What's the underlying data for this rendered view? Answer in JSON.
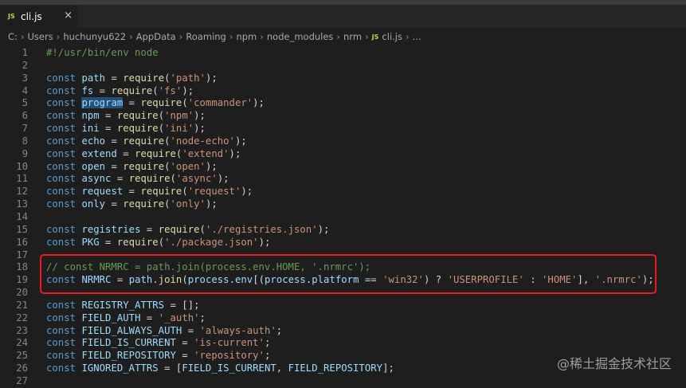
{
  "tab": {
    "icon": "js-file-icon",
    "icon_text": "JS",
    "name": "cli.js",
    "close": "×"
  },
  "breadcrumb": [
    "C:",
    "Users",
    "huchunyu622",
    "AppData",
    "Roaming",
    "npm",
    "node_modules",
    "nrm",
    "cli.js",
    "..."
  ],
  "breadcrumb_js_icon": "JS",
  "lines": [
    {
      "n": 1,
      "tokens": [
        [
          "cmt",
          "#!/usr/bin/env node"
        ]
      ]
    },
    {
      "n": 2,
      "tokens": []
    },
    {
      "n": 3,
      "tokens": [
        [
          "kw",
          "const"
        ],
        [
          "pun",
          " "
        ],
        [
          "var",
          "path"
        ],
        [
          "pun",
          " = "
        ],
        [
          "fn",
          "require"
        ],
        [
          "pun",
          "("
        ],
        [
          "str",
          "'path'"
        ],
        [
          "pun",
          ");"
        ]
      ]
    },
    {
      "n": 4,
      "tokens": [
        [
          "kw",
          "const"
        ],
        [
          "pun",
          " "
        ],
        [
          "var",
          "fs"
        ],
        [
          "pun",
          " = "
        ],
        [
          "fn",
          "require"
        ],
        [
          "pun",
          "("
        ],
        [
          "str",
          "'fs'"
        ],
        [
          "pun",
          ");"
        ]
      ]
    },
    {
      "n": 5,
      "tokens": [
        [
          "kw",
          "const"
        ],
        [
          "pun",
          " "
        ],
        [
          "var hl",
          "program"
        ],
        [
          "pun",
          " = "
        ],
        [
          "fn",
          "require"
        ],
        [
          "pun",
          "("
        ],
        [
          "str",
          "'commander'"
        ],
        [
          "pun",
          ");"
        ]
      ]
    },
    {
      "n": 6,
      "tokens": [
        [
          "kw",
          "const"
        ],
        [
          "pun",
          " "
        ],
        [
          "var",
          "npm"
        ],
        [
          "pun",
          " = "
        ],
        [
          "fn",
          "require"
        ],
        [
          "pun",
          "("
        ],
        [
          "str",
          "'npm'"
        ],
        [
          "pun",
          ");"
        ]
      ]
    },
    {
      "n": 7,
      "tokens": [
        [
          "kw",
          "const"
        ],
        [
          "pun",
          " "
        ],
        [
          "var",
          "ini"
        ],
        [
          "pun",
          " = "
        ],
        [
          "fn",
          "require"
        ],
        [
          "pun",
          "("
        ],
        [
          "str",
          "'ini'"
        ],
        [
          "pun",
          ");"
        ]
      ]
    },
    {
      "n": 8,
      "tokens": [
        [
          "kw",
          "const"
        ],
        [
          "pun",
          " "
        ],
        [
          "var",
          "echo"
        ],
        [
          "pun",
          " = "
        ],
        [
          "fn",
          "require"
        ],
        [
          "pun",
          "("
        ],
        [
          "str",
          "'node-echo'"
        ],
        [
          "pun",
          ");"
        ]
      ]
    },
    {
      "n": 9,
      "tokens": [
        [
          "kw",
          "const"
        ],
        [
          "pun",
          " "
        ],
        [
          "var",
          "extend"
        ],
        [
          "pun",
          " = "
        ],
        [
          "fn",
          "require"
        ],
        [
          "pun",
          "("
        ],
        [
          "str",
          "'extend'"
        ],
        [
          "pun",
          ");"
        ]
      ]
    },
    {
      "n": 10,
      "tokens": [
        [
          "kw",
          "const"
        ],
        [
          "pun",
          " "
        ],
        [
          "var",
          "open"
        ],
        [
          "pun",
          " = "
        ],
        [
          "fn",
          "require"
        ],
        [
          "pun",
          "("
        ],
        [
          "str",
          "'open'"
        ],
        [
          "pun",
          ");"
        ]
      ]
    },
    {
      "n": 11,
      "tokens": [
        [
          "kw",
          "const"
        ],
        [
          "pun",
          " "
        ],
        [
          "var",
          "async"
        ],
        [
          "pun",
          " = "
        ],
        [
          "fn",
          "require"
        ],
        [
          "pun",
          "("
        ],
        [
          "str",
          "'async'"
        ],
        [
          "pun",
          ");"
        ]
      ]
    },
    {
      "n": 12,
      "tokens": [
        [
          "kw",
          "const"
        ],
        [
          "pun",
          " "
        ],
        [
          "var",
          "request"
        ],
        [
          "pun",
          " = "
        ],
        [
          "fn",
          "require"
        ],
        [
          "pun",
          "("
        ],
        [
          "str",
          "'request'"
        ],
        [
          "pun",
          ");"
        ]
      ]
    },
    {
      "n": 13,
      "tokens": [
        [
          "kw",
          "const"
        ],
        [
          "pun",
          " "
        ],
        [
          "var",
          "only"
        ],
        [
          "pun",
          " = "
        ],
        [
          "fn",
          "require"
        ],
        [
          "pun",
          "("
        ],
        [
          "str",
          "'only'"
        ],
        [
          "pun",
          ");"
        ]
      ]
    },
    {
      "n": 14,
      "tokens": []
    },
    {
      "n": 15,
      "tokens": [
        [
          "kw",
          "const"
        ],
        [
          "pun",
          " "
        ],
        [
          "var",
          "registries"
        ],
        [
          "pun",
          " = "
        ],
        [
          "fn",
          "require"
        ],
        [
          "pun",
          "("
        ],
        [
          "str",
          "'./registries.json'"
        ],
        [
          "pun",
          ");"
        ]
      ]
    },
    {
      "n": 16,
      "tokens": [
        [
          "kw",
          "const"
        ],
        [
          "pun",
          " "
        ],
        [
          "var",
          "PKG"
        ],
        [
          "pun",
          " = "
        ],
        [
          "fn",
          "require"
        ],
        [
          "pun",
          "("
        ],
        [
          "str",
          "'./package.json'"
        ],
        [
          "pun",
          ");"
        ]
      ]
    },
    {
      "n": 17,
      "tokens": []
    },
    {
      "n": 18,
      "tokens": [
        [
          "cmt",
          "// const NRMRC = path.join(process.env.HOME, '.nrmrc');"
        ]
      ]
    },
    {
      "n": 19,
      "tokens": [
        [
          "kw",
          "const"
        ],
        [
          "pun",
          " "
        ],
        [
          "var",
          "NRMRC"
        ],
        [
          "pun",
          " = "
        ],
        [
          "var",
          "path"
        ],
        [
          "pun",
          "."
        ],
        [
          "fn",
          "join"
        ],
        [
          "pun",
          "("
        ],
        [
          "var",
          "process"
        ],
        [
          "pun",
          "."
        ],
        [
          "var",
          "env"
        ],
        [
          "pun",
          "[("
        ],
        [
          "var",
          "process"
        ],
        [
          "pun",
          "."
        ],
        [
          "var",
          "platform"
        ],
        [
          "pun",
          " == "
        ],
        [
          "str",
          "'win32'"
        ],
        [
          "pun",
          ") ? "
        ],
        [
          "str",
          "'USERPROFILE'"
        ],
        [
          "pun",
          " : "
        ],
        [
          "str",
          "'HOME'"
        ],
        [
          "pun",
          "], "
        ],
        [
          "str",
          "'.nrmrc'"
        ],
        [
          "pun",
          ");"
        ]
      ]
    },
    {
      "n": 20,
      "tokens": []
    },
    {
      "n": 21,
      "tokens": [
        [
          "kw",
          "const"
        ],
        [
          "pun",
          " "
        ],
        [
          "var",
          "REGISTRY_ATTRS"
        ],
        [
          "pun",
          " = [];"
        ]
      ]
    },
    {
      "n": 22,
      "tokens": [
        [
          "kw",
          "const"
        ],
        [
          "pun",
          " "
        ],
        [
          "var",
          "FIELD_AUTH"
        ],
        [
          "pun",
          " = "
        ],
        [
          "str",
          "'_auth'"
        ],
        [
          "pun",
          ";"
        ]
      ]
    },
    {
      "n": 23,
      "tokens": [
        [
          "kw",
          "const"
        ],
        [
          "pun",
          " "
        ],
        [
          "var",
          "FIELD_ALWAYS_AUTH"
        ],
        [
          "pun",
          " = "
        ],
        [
          "str",
          "'always-auth'"
        ],
        [
          "pun",
          ";"
        ]
      ]
    },
    {
      "n": 24,
      "tokens": [
        [
          "kw",
          "const"
        ],
        [
          "pun",
          " "
        ],
        [
          "var",
          "FIELD_IS_CURRENT"
        ],
        [
          "pun",
          " = "
        ],
        [
          "str",
          "'is-current'"
        ],
        [
          "pun",
          ";"
        ]
      ]
    },
    {
      "n": 25,
      "tokens": [
        [
          "kw",
          "const"
        ],
        [
          "pun",
          " "
        ],
        [
          "var",
          "FIELD_REPOSITORY"
        ],
        [
          "pun",
          " = "
        ],
        [
          "str",
          "'repository'"
        ],
        [
          "pun",
          ";"
        ]
      ]
    },
    {
      "n": 26,
      "tokens": [
        [
          "kw",
          "const"
        ],
        [
          "pun",
          " "
        ],
        [
          "var",
          "IGNORED_ATTRS"
        ],
        [
          "pun",
          " = ["
        ],
        [
          "var",
          "FIELD_IS_CURRENT"
        ],
        [
          "pun",
          ", "
        ],
        [
          "var",
          "FIELD_REPOSITORY"
        ],
        [
          "pun",
          "];"
        ]
      ]
    },
    {
      "n": 27,
      "tokens": []
    }
  ],
  "watermark": "@稀土掘金技术社区",
  "colors": {
    "keyword": "#569cd6",
    "variable": "#9cdcfe",
    "function": "#dcdcaa",
    "string": "#ce9178",
    "comment": "#6a9955",
    "annotation_box": "#e81b1b"
  }
}
